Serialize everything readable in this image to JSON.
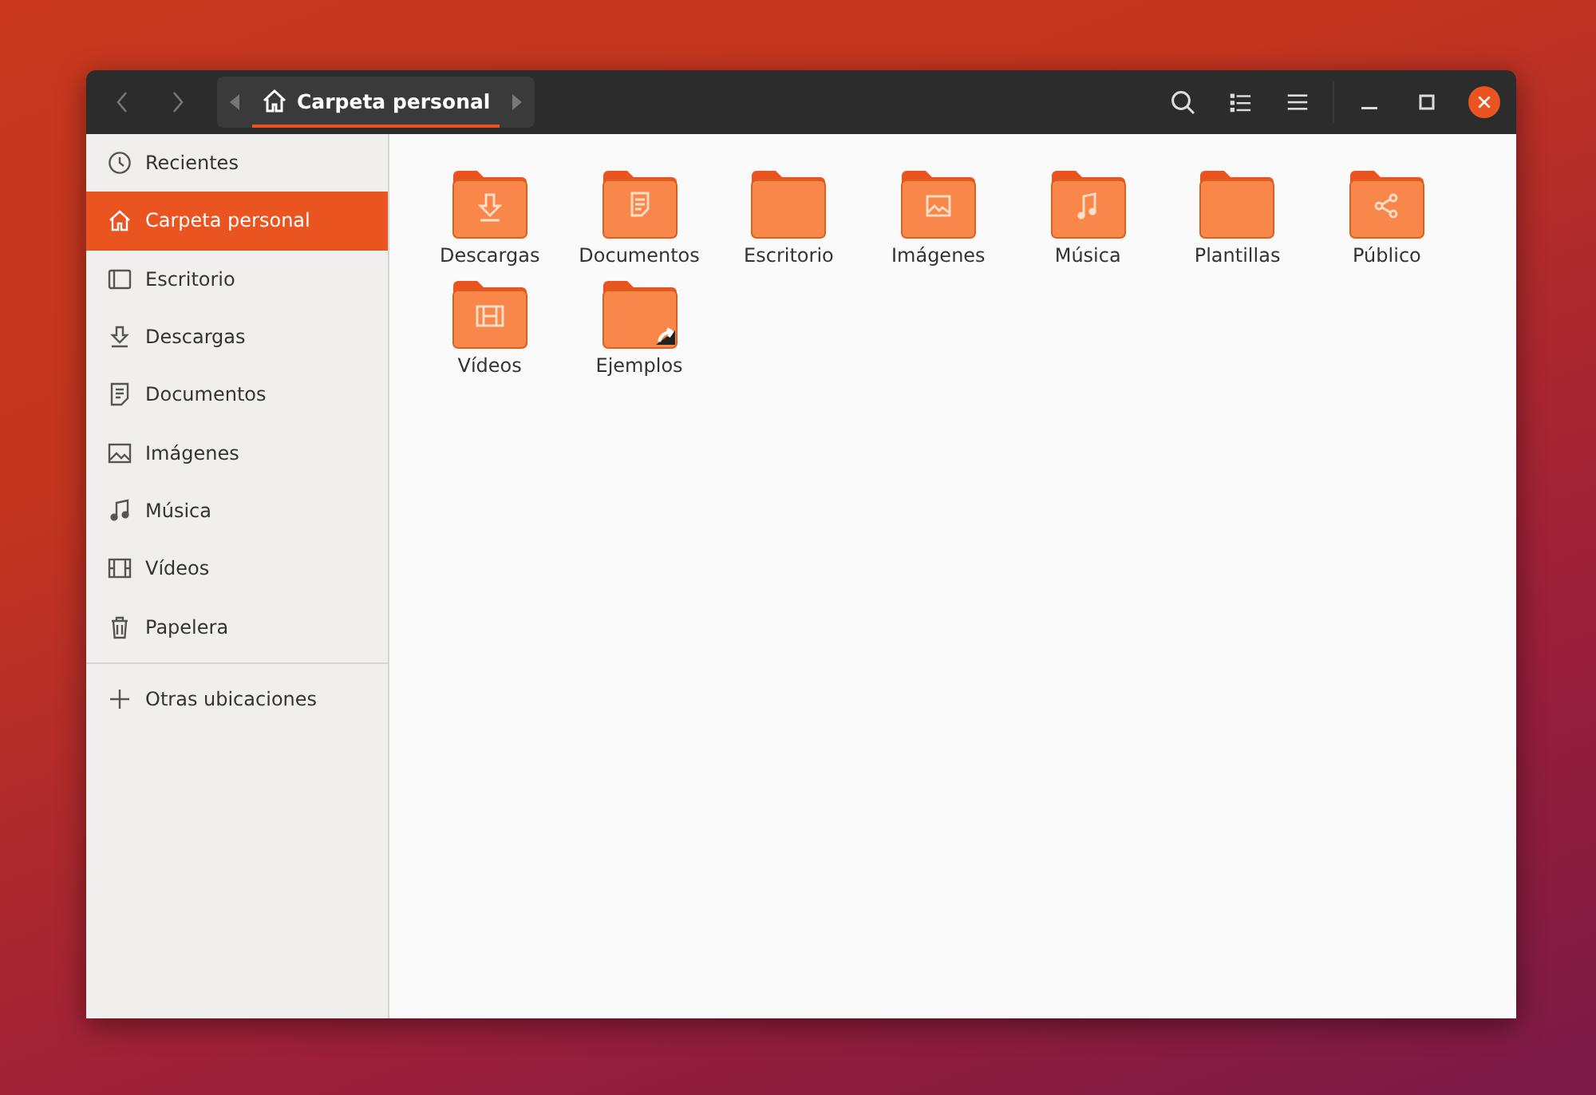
{
  "header": {
    "path_button": {
      "label": "Carpeta personal"
    }
  },
  "sidebar": {
    "items": [
      {
        "label": "Recientes",
        "kind": "recent",
        "selected": false
      },
      {
        "label": "Carpeta personal",
        "kind": "home",
        "selected": true
      },
      {
        "label": "Escritorio",
        "kind": "desktop",
        "selected": false
      },
      {
        "label": "Descargas",
        "kind": "download",
        "selected": false
      },
      {
        "label": "Documentos",
        "kind": "document",
        "selected": false
      },
      {
        "label": "Imágenes",
        "kind": "image",
        "selected": false
      },
      {
        "label": "Música",
        "kind": "music",
        "selected": false
      },
      {
        "label": "Vídeos",
        "kind": "video",
        "selected": false
      },
      {
        "label": "Papelera",
        "kind": "trash",
        "selected": false
      }
    ],
    "other_locations": {
      "label": "Otras ubicaciones"
    }
  },
  "folders": [
    {
      "label": "Descargas",
      "kind": "download"
    },
    {
      "label": "Documentos",
      "kind": "document"
    },
    {
      "label": "Escritorio",
      "kind": "plain"
    },
    {
      "label": "Imágenes",
      "kind": "image"
    },
    {
      "label": "Música",
      "kind": "music"
    },
    {
      "label": "Plantillas",
      "kind": "plain"
    },
    {
      "label": "Público",
      "kind": "share"
    },
    {
      "label": "Vídeos",
      "kind": "video"
    },
    {
      "label": "Ejemplos",
      "kind": "link"
    }
  ]
}
